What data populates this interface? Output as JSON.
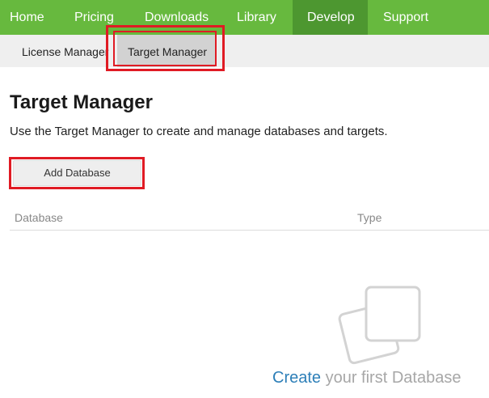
{
  "topnav": {
    "items": [
      {
        "label": "Home"
      },
      {
        "label": "Pricing"
      },
      {
        "label": "Downloads"
      },
      {
        "label": "Library"
      },
      {
        "label": "Develop"
      },
      {
        "label": "Support"
      }
    ],
    "active": "Develop",
    "color": "#67b93e",
    "active_color": "#4d9730"
  },
  "subnav": {
    "items": [
      {
        "label": "License Manager"
      },
      {
        "label": "Target Manager"
      }
    ],
    "active": "Target Manager"
  },
  "page": {
    "title": "Target Manager",
    "description": "Use the Target Manager to create and manage databases and targets.",
    "add_button_label": "Add Database"
  },
  "table": {
    "columns": [
      "Database",
      "Type"
    ]
  },
  "empty_state": {
    "icon": "stacked-cards-icon",
    "link_text": "Create",
    "rest_text": " your first Database"
  },
  "annotation_color": "#e01b24"
}
